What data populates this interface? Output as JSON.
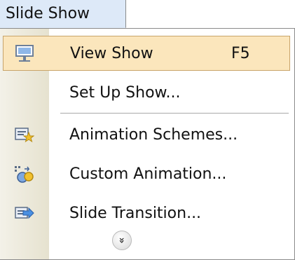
{
  "menu": {
    "title": "Slide Show",
    "items": [
      {
        "label": "View Show",
        "shortcut": "F5",
        "icon": "projector-screen-icon",
        "highlighted": true
      },
      {
        "label": "Set Up Show...",
        "shortcut": "",
        "icon": "",
        "highlighted": false
      },
      {
        "label": "Animation Schemes...",
        "shortcut": "",
        "icon": "animation-schemes-icon",
        "highlighted": false
      },
      {
        "label": "Custom Animation...",
        "shortcut": "",
        "icon": "custom-animation-icon",
        "highlighted": false
      },
      {
        "label": "Slide Transition...",
        "shortcut": "",
        "icon": "slide-transition-icon",
        "highlighted": false
      }
    ],
    "expand_glyph": "»",
    "expand_icon": "chevron-double-down-icon"
  }
}
